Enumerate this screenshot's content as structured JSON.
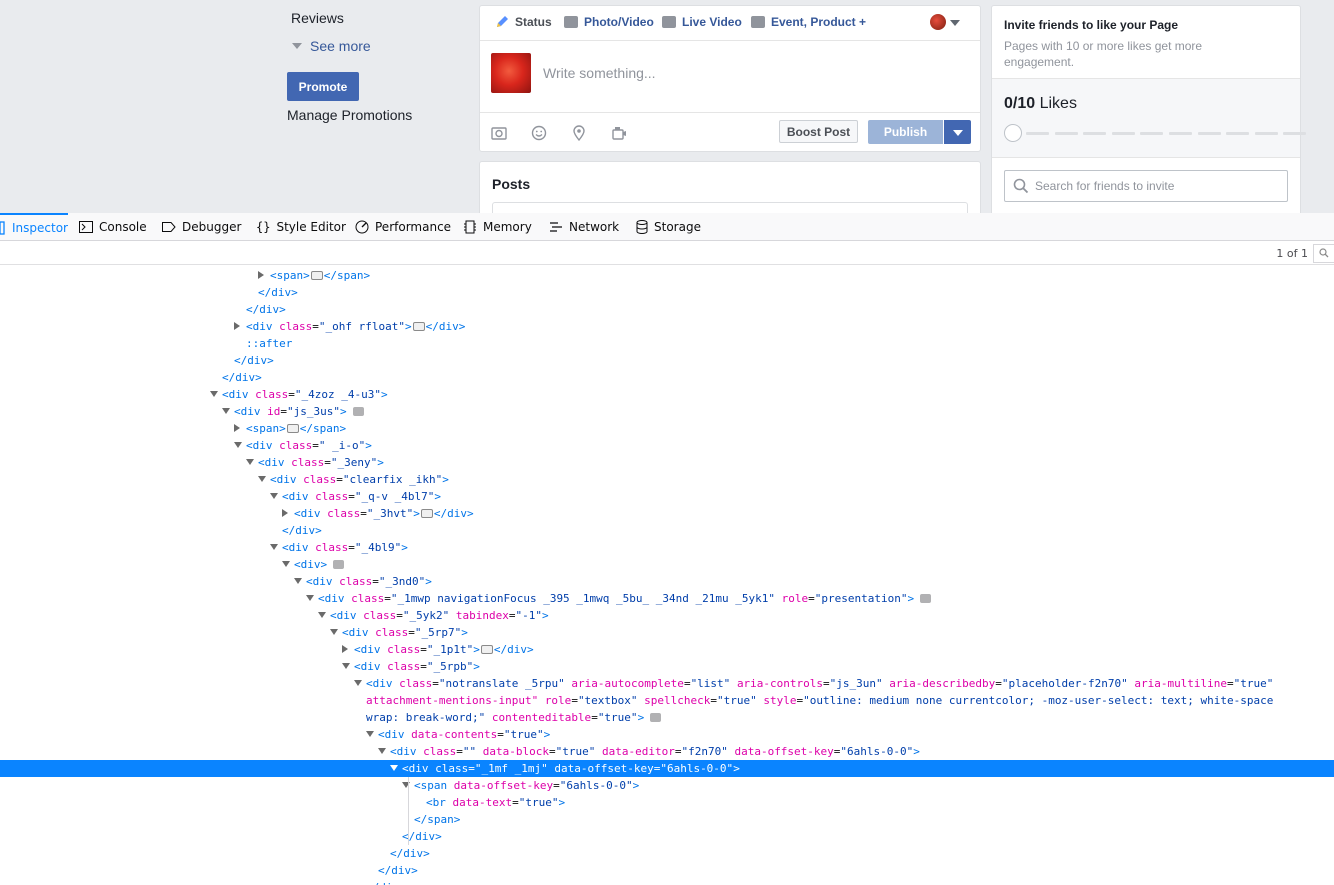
{
  "fb": {
    "sidebar": {
      "reviews": "Reviews",
      "see_more": "See more",
      "promote": "Promote",
      "manage_promotions": "Manage Promotions"
    },
    "composer": {
      "tabs": [
        "Status",
        "Photo/Video",
        "Live Video",
        "Event, Product +"
      ],
      "placeholder": "Write something...",
      "boost": "Boost Post",
      "publish": "Publish"
    },
    "posts": {
      "title": "Posts"
    },
    "invite": {
      "title": "Invite friends to like your Page",
      "subtitle": "Pages with 10 or more likes get more engagement.",
      "likes_count": "0/10",
      "likes_label": "Likes",
      "likes_progress": 0,
      "search_placeholder": "Search for friends to invite"
    }
  },
  "devtools": {
    "tabs": [
      "Inspector",
      "Console",
      "Debugger",
      "Style Editor",
      "Performance",
      "Memory",
      "Network",
      "Storage"
    ],
    "active_tab": "Inspector",
    "match_count": "1 of 1",
    "lines": [
      {
        "indent": 23,
        "toggle": "closed",
        "tokens": [
          [
            "tg",
            "<span>"
          ],
          [
            "ell",
            ""
          ],
          [
            "tg",
            "</span>"
          ]
        ]
      },
      {
        "indent": 22,
        "toggle": "none",
        "tokens": [
          [
            "tg",
            "</div>"
          ]
        ]
      },
      {
        "indent": 21,
        "toggle": "none",
        "tokens": [
          [
            "tg",
            "</div>"
          ]
        ]
      },
      {
        "indent": 21,
        "toggle": "closed",
        "tokens": [
          [
            "tg",
            "<div "
          ],
          [
            "at",
            "class"
          ],
          [
            "pn",
            "="
          ],
          [
            "av",
            "\"_ohf rfloat\""
          ],
          [
            "tg",
            ">"
          ],
          [
            "ell",
            ""
          ],
          [
            "tg",
            "</div>"
          ]
        ]
      },
      {
        "indent": 21,
        "toggle": "none",
        "tokens": [
          [
            "ps",
            "::after"
          ]
        ]
      },
      {
        "indent": 20,
        "toggle": "none",
        "tokens": [
          [
            "tg",
            "</div>"
          ]
        ]
      },
      {
        "indent": 19,
        "toggle": "none",
        "tokens": [
          [
            "tg",
            "</div>"
          ]
        ]
      },
      {
        "indent": 19,
        "toggle": "open",
        "tokens": [
          [
            "tg",
            "<div "
          ],
          [
            "at",
            "class"
          ],
          [
            "pn",
            "="
          ],
          [
            "av",
            "\"_4zoz _4-u3\""
          ],
          [
            "tg",
            ">"
          ]
        ]
      },
      {
        "indent": 20,
        "toggle": "open",
        "tokens": [
          [
            "tg",
            "<div "
          ],
          [
            "at",
            "id"
          ],
          [
            "pn",
            "="
          ],
          [
            "av",
            "\"js_3us\""
          ],
          [
            "tg",
            ">"
          ],
          [
            "ev",
            ""
          ]
        ]
      },
      {
        "indent": 21,
        "toggle": "closed",
        "tokens": [
          [
            "tg",
            "<span>"
          ],
          [
            "ell",
            ""
          ],
          [
            "tg",
            "</span>"
          ]
        ]
      },
      {
        "indent": 21,
        "toggle": "open",
        "tokens": [
          [
            "tg",
            "<div "
          ],
          [
            "at",
            "class"
          ],
          [
            "pn",
            "="
          ],
          [
            "av",
            "\" _i-o\""
          ],
          [
            "tg",
            ">"
          ]
        ]
      },
      {
        "indent": 22,
        "toggle": "open",
        "tokens": [
          [
            "tg",
            "<div "
          ],
          [
            "at",
            "class"
          ],
          [
            "pn",
            "="
          ],
          [
            "av",
            "\"_3eny\""
          ],
          [
            "tg",
            ">"
          ]
        ]
      },
      {
        "indent": 23,
        "toggle": "open",
        "tokens": [
          [
            "tg",
            "<div "
          ],
          [
            "at",
            "class"
          ],
          [
            "pn",
            "="
          ],
          [
            "av",
            "\"clearfix _ikh\""
          ],
          [
            "tg",
            ">"
          ]
        ]
      },
      {
        "indent": 24,
        "toggle": "open",
        "tokens": [
          [
            "tg",
            "<div "
          ],
          [
            "at",
            "class"
          ],
          [
            "pn",
            "="
          ],
          [
            "av",
            "\"_q-v _4bl7\""
          ],
          [
            "tg",
            ">"
          ]
        ]
      },
      {
        "indent": 25,
        "toggle": "closed",
        "tokens": [
          [
            "tg",
            "<div "
          ],
          [
            "at",
            "class"
          ],
          [
            "pn",
            "="
          ],
          [
            "av",
            "\"_3hvt\""
          ],
          [
            "tg",
            ">"
          ],
          [
            "ell",
            ""
          ],
          [
            "tg",
            "</div>"
          ]
        ]
      },
      {
        "indent": 24,
        "toggle": "none",
        "tokens": [
          [
            "tg",
            "</div>"
          ]
        ]
      },
      {
        "indent": 24,
        "toggle": "open",
        "tokens": [
          [
            "tg",
            "<div "
          ],
          [
            "at",
            "class"
          ],
          [
            "pn",
            "="
          ],
          [
            "av",
            "\"_4bl9\""
          ],
          [
            "tg",
            ">"
          ]
        ]
      },
      {
        "indent": 25,
        "toggle": "open",
        "tokens": [
          [
            "tg",
            "<div>"
          ],
          [
            "ev",
            ""
          ]
        ]
      },
      {
        "indent": 26,
        "toggle": "open",
        "tokens": [
          [
            "tg",
            "<div "
          ],
          [
            "at",
            "class"
          ],
          [
            "pn",
            "="
          ],
          [
            "av",
            "\"_3nd0\""
          ],
          [
            "tg",
            ">"
          ]
        ]
      },
      {
        "indent": 27,
        "toggle": "open",
        "tokens": [
          [
            "tg",
            "<div "
          ],
          [
            "at",
            "class"
          ],
          [
            "pn",
            "="
          ],
          [
            "av",
            "\"_1mwp navigationFocus _395 _1mwq _5bu_ _34nd _21mu _5yk1\""
          ],
          [
            "pn",
            " "
          ],
          [
            "at",
            "role"
          ],
          [
            "pn",
            "="
          ],
          [
            "av",
            "\"presentation\""
          ],
          [
            "tg",
            ">"
          ],
          [
            "ev",
            ""
          ]
        ]
      },
      {
        "indent": 28,
        "toggle": "open",
        "tokens": [
          [
            "tg",
            "<div "
          ],
          [
            "at",
            "class"
          ],
          [
            "pn",
            "="
          ],
          [
            "av",
            "\"_5yk2\""
          ],
          [
            "pn",
            " "
          ],
          [
            "at",
            "tabindex"
          ],
          [
            "pn",
            "="
          ],
          [
            "av",
            "\"-1\""
          ],
          [
            "tg",
            ">"
          ]
        ]
      },
      {
        "indent": 29,
        "toggle": "open",
        "tokens": [
          [
            "tg",
            "<div "
          ],
          [
            "at",
            "class"
          ],
          [
            "pn",
            "="
          ],
          [
            "av",
            "\"_5rp7\""
          ],
          [
            "tg",
            ">"
          ]
        ]
      },
      {
        "indent": 30,
        "toggle": "closed",
        "tokens": [
          [
            "tg",
            "<div "
          ],
          [
            "at",
            "class"
          ],
          [
            "pn",
            "="
          ],
          [
            "av",
            "\"_1p1t\""
          ],
          [
            "tg",
            ">"
          ],
          [
            "ell",
            ""
          ],
          [
            "tg",
            "</div>"
          ]
        ]
      },
      {
        "indent": 30,
        "toggle": "open",
        "tokens": [
          [
            "tg",
            "<div "
          ],
          [
            "at",
            "class"
          ],
          [
            "pn",
            "="
          ],
          [
            "av",
            "\"_5rpb\""
          ],
          [
            "tg",
            ">"
          ]
        ]
      },
      {
        "indent": 31,
        "toggle": "open",
        "tokens": [
          [
            "tg",
            "<div "
          ],
          [
            "at",
            "class"
          ],
          [
            "pn",
            "="
          ],
          [
            "av",
            "\"notranslate _5rpu\""
          ],
          [
            "pn",
            " "
          ],
          [
            "at",
            "aria-autocomplete"
          ],
          [
            "pn",
            "="
          ],
          [
            "av",
            "\"list\""
          ],
          [
            "pn",
            " "
          ],
          [
            "at",
            "aria-controls"
          ],
          [
            "pn",
            "="
          ],
          [
            "av",
            "\"js_3un\""
          ],
          [
            "pn",
            " "
          ],
          [
            "at",
            "aria-describedby"
          ],
          [
            "pn",
            "="
          ],
          [
            "av",
            "\"placeholder-f2n70\""
          ],
          [
            "pn",
            " "
          ],
          [
            "at",
            "aria-multiline"
          ],
          [
            "pn",
            "="
          ],
          [
            "av",
            "\"true\""
          ]
        ]
      },
      {
        "indent": 31,
        "toggle": "none",
        "tokens": [
          [
            "at",
            "attachment-mentions-input\""
          ],
          [
            "pn",
            " "
          ],
          [
            "at",
            "role"
          ],
          [
            "pn",
            "="
          ],
          [
            "av",
            "\"textbox\""
          ],
          [
            "pn",
            " "
          ],
          [
            "at",
            "spellcheck"
          ],
          [
            "pn",
            "="
          ],
          [
            "av",
            "\"true\""
          ],
          [
            "pn",
            " "
          ],
          [
            "at",
            "style"
          ],
          [
            "pn",
            "="
          ],
          [
            "av",
            "\"outline: medium none currentcolor; -moz-user-select: text; white-space"
          ]
        ]
      },
      {
        "indent": 31,
        "toggle": "none",
        "tokens": [
          [
            "av",
            "wrap: break-word;\""
          ],
          [
            "pn",
            " "
          ],
          [
            "at",
            "contenteditable"
          ],
          [
            "pn",
            "="
          ],
          [
            "av",
            "\"true\""
          ],
          [
            "tg",
            ">"
          ],
          [
            "ev",
            ""
          ]
        ]
      },
      {
        "indent": 32,
        "toggle": "open",
        "tokens": [
          [
            "tg",
            "<div "
          ],
          [
            "at",
            "data-contents"
          ],
          [
            "pn",
            "="
          ],
          [
            "av",
            "\"true\""
          ],
          [
            "tg",
            ">"
          ]
        ]
      },
      {
        "indent": 33,
        "toggle": "open",
        "tokens": [
          [
            "tg",
            "<div "
          ],
          [
            "at",
            "class"
          ],
          [
            "pn",
            "="
          ],
          [
            "av",
            "\"\""
          ],
          [
            "pn",
            " "
          ],
          [
            "at",
            "data-block"
          ],
          [
            "pn",
            "="
          ],
          [
            "av",
            "\"true\""
          ],
          [
            "pn",
            " "
          ],
          [
            "at",
            "data-editor"
          ],
          [
            "pn",
            "="
          ],
          [
            "av",
            "\"f2n70\""
          ],
          [
            "pn",
            " "
          ],
          [
            "at",
            "data-offset-key"
          ],
          [
            "pn",
            "="
          ],
          [
            "av",
            "\"6ahls-0-0\""
          ],
          [
            "tg",
            ">"
          ]
        ]
      },
      {
        "indent": 34,
        "toggle": "open",
        "selected": true,
        "tokens": [
          [
            "tg",
            "<div "
          ],
          [
            "at",
            "class"
          ],
          [
            "pn",
            "="
          ],
          [
            "av",
            "\"_1mf _1mj\""
          ],
          [
            "pn",
            " "
          ],
          [
            "at",
            "data-offset-key"
          ],
          [
            "pn",
            "="
          ],
          [
            "av",
            "\"6ahls-0-0\""
          ],
          [
            "tg",
            ">"
          ]
        ]
      },
      {
        "indent": 35,
        "toggle": "open",
        "tokens": [
          [
            "tg",
            "<span "
          ],
          [
            "at",
            "data-offset-key"
          ],
          [
            "pn",
            "="
          ],
          [
            "av",
            "\"6ahls-0-0\""
          ],
          [
            "tg",
            ">"
          ]
        ]
      },
      {
        "indent": 36,
        "toggle": "none",
        "tokens": [
          [
            "tg",
            "<br "
          ],
          [
            "at",
            "data-text"
          ],
          [
            "pn",
            "="
          ],
          [
            "av",
            "\"true\""
          ],
          [
            "tg",
            ">"
          ]
        ]
      },
      {
        "indent": 35,
        "toggle": "none",
        "tokens": [
          [
            "tg",
            "</span>"
          ]
        ]
      },
      {
        "indent": 34,
        "toggle": "none",
        "tokens": [
          [
            "tg",
            "</div>"
          ]
        ]
      },
      {
        "indent": 33,
        "toggle": "none",
        "tokens": [
          [
            "tg",
            "</div>"
          ]
        ]
      },
      {
        "indent": 32,
        "toggle": "none",
        "tokens": [
          [
            "tg",
            "</div>"
          ]
        ]
      },
      {
        "indent": 31,
        "toggle": "none",
        "tokens": [
          [
            "tg",
            "</div>"
          ]
        ]
      }
    ]
  },
  "colors": {
    "fb_blue": "#4267b2",
    "page_bg": "#e9ebee",
    "devtools_accent": "#0a84ff",
    "tag": "#0074e8",
    "attr": "#dd00a9",
    "value": "#003eaa"
  }
}
